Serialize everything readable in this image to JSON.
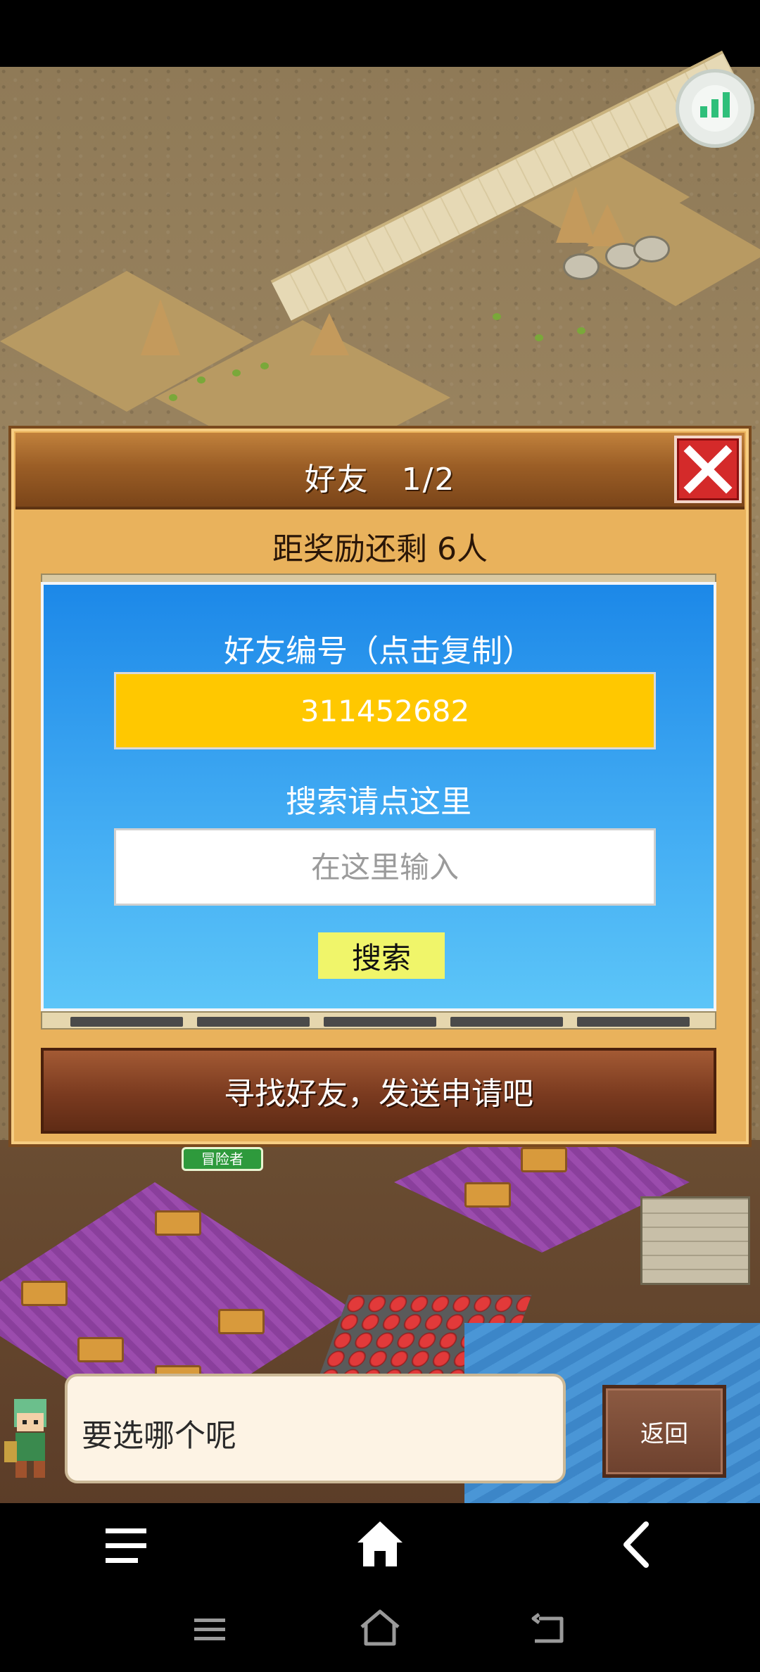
{
  "dialog": {
    "title": "好友　1/2",
    "reward_text": "距奖励还剩 6人",
    "friend_code_label": "好友编号（点击复制）",
    "friend_code": "311452682",
    "search_label": "搜索请点这里",
    "search_placeholder": "在这里输入",
    "search_button": "搜索",
    "find_friends_button": "寻找好友，发送申请吧"
  },
  "town": {
    "adventurer_tag": "冒险者"
  },
  "chat": {
    "message": "要选哪个呢",
    "back_button": "返回"
  },
  "colors": {
    "panel_blue": "#1c88e8",
    "friend_code_bg": "#ffc800",
    "search_button_bg": "#f0f56a",
    "close_button": "#d42a2a"
  },
  "icons": {
    "stats": "signal-bars-icon",
    "close": "close-icon",
    "left": "arrow-left-icon",
    "right": "arrow-right-icon",
    "menu": "menu-icon",
    "home": "home-icon",
    "back": "back-icon"
  }
}
